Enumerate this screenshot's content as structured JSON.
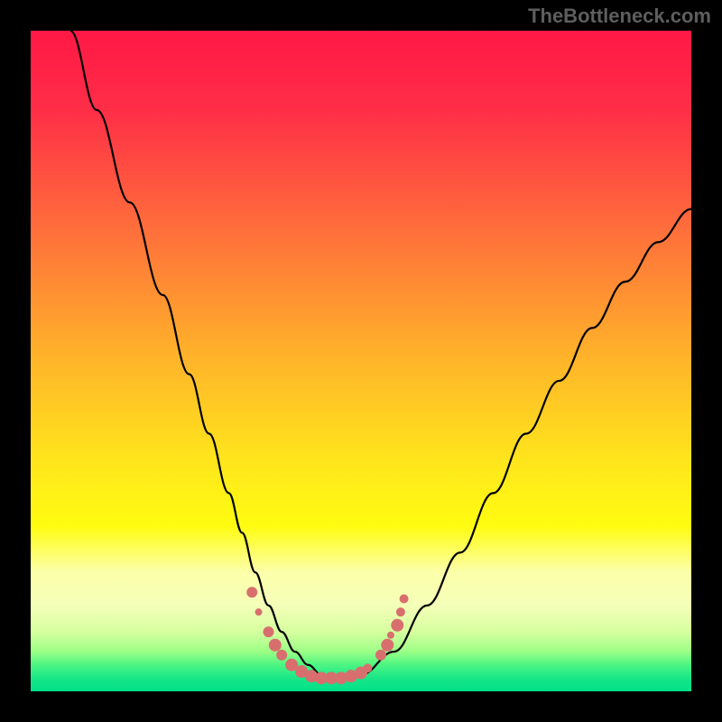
{
  "watermark": "TheBottleneck.com",
  "chart_data": {
    "type": "line",
    "title": "",
    "xlabel": "",
    "ylabel": "",
    "xlim": [
      0,
      100
    ],
    "ylim": [
      0,
      100
    ],
    "gradient": {
      "stops": [
        {
          "offset": 0,
          "color": "#ff1846"
        },
        {
          "offset": 12,
          "color": "#ff2e47"
        },
        {
          "offset": 30,
          "color": "#ff6e3b"
        },
        {
          "offset": 50,
          "color": "#ffb529"
        },
        {
          "offset": 65,
          "color": "#ffe51c"
        },
        {
          "offset": 75,
          "color": "#fffc11"
        },
        {
          "offset": 82,
          "color": "#fcffaa"
        },
        {
          "offset": 87,
          "color": "#f4ffb8"
        },
        {
          "offset": 91,
          "color": "#d6ff9f"
        },
        {
          "offset": 94,
          "color": "#9bff86"
        },
        {
          "offset": 96,
          "color": "#4cf582"
        },
        {
          "offset": 98,
          "color": "#19e687"
        },
        {
          "offset": 100,
          "color": "#00e089"
        }
      ]
    },
    "series": [
      {
        "name": "bottleneck-curve",
        "color": "#000000",
        "x": [
          6,
          10,
          15,
          20,
          24,
          27,
          30,
          32,
          34,
          36,
          38,
          40,
          42,
          44,
          46,
          48,
          50,
          55,
          60,
          65,
          70,
          75,
          80,
          85,
          90,
          95,
          100
        ],
        "y": [
          100,
          88,
          74,
          60,
          48,
          39,
          30,
          24,
          18,
          13,
          9,
          6,
          4,
          2.5,
          2,
          2,
          2.5,
          6,
          13,
          21,
          30,
          39,
          47,
          55,
          62,
          68,
          73
        ]
      }
    ],
    "markers": {
      "color": "#d86f6e",
      "points": [
        {
          "x": 33.5,
          "y": 15,
          "r": 6
        },
        {
          "x": 34.5,
          "y": 12,
          "r": 4
        },
        {
          "x": 36,
          "y": 9,
          "r": 6
        },
        {
          "x": 37,
          "y": 7,
          "r": 7
        },
        {
          "x": 38,
          "y": 5.5,
          "r": 6
        },
        {
          "x": 39.5,
          "y": 4,
          "r": 7
        },
        {
          "x": 41,
          "y": 3,
          "r": 7
        },
        {
          "x": 42.5,
          "y": 2.3,
          "r": 7
        },
        {
          "x": 44,
          "y": 2,
          "r": 7
        },
        {
          "x": 45.5,
          "y": 2,
          "r": 7
        },
        {
          "x": 47,
          "y": 2,
          "r": 7
        },
        {
          "x": 48.5,
          "y": 2.3,
          "r": 7
        },
        {
          "x": 50,
          "y": 2.8,
          "r": 7
        },
        {
          "x": 51,
          "y": 3.5,
          "r": 5
        },
        {
          "x": 53,
          "y": 5.5,
          "r": 6
        },
        {
          "x": 54,
          "y": 7,
          "r": 7
        },
        {
          "x": 54.5,
          "y": 8.5,
          "r": 4
        },
        {
          "x": 55.5,
          "y": 10,
          "r": 7
        },
        {
          "x": 56,
          "y": 12,
          "r": 5
        },
        {
          "x": 56.5,
          "y": 14,
          "r": 5
        }
      ]
    }
  }
}
